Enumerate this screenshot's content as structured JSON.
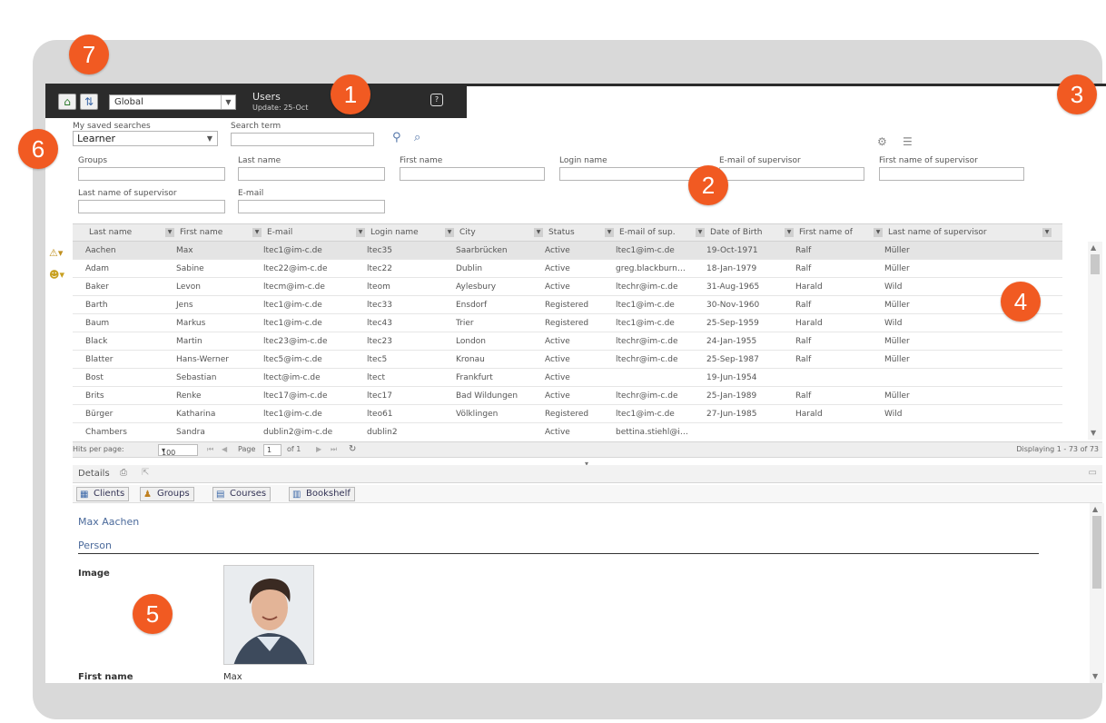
{
  "toolbar": {
    "context_select": "Global",
    "title": "Users",
    "subtitle": "Update: 25-Oct",
    "help_label": "?"
  },
  "search": {
    "saved_searches_label": "My saved searches",
    "saved_search_value": "Learner",
    "search_term_label": "Search term",
    "fields": [
      {
        "label": "Groups"
      },
      {
        "label": "Last name"
      },
      {
        "label": "First name"
      },
      {
        "label": "Login name"
      },
      {
        "label": "E-mail of supervisor"
      },
      {
        "label": "First name of supervisor"
      },
      {
        "label": "Last name of supervisor"
      },
      {
        "label": "E-mail"
      }
    ]
  },
  "grid": {
    "columns": [
      "Last name",
      "First name",
      "E-mail",
      "Login name",
      "City",
      "Status",
      "E-mail of sup.",
      "Date of Birth",
      "First name of",
      "Last name of supervisor"
    ],
    "rows": [
      [
        "Aachen",
        "Max",
        "ltec1@im-c.de",
        "ltec35",
        "Saarbrücken",
        "Active",
        "ltec1@im-c.de",
        "19-Oct-1971",
        "Ralf",
        "Müller"
      ],
      [
        "Adam",
        "Sabine",
        "ltec22@im-c.de",
        "ltec22",
        "Dublin",
        "Active",
        "greg.blackburn…",
        "18-Jan-1979",
        "Ralf",
        "Müller"
      ],
      [
        "Baker",
        "Levon",
        "ltecm@im-c.de",
        "lteom",
        "Aylesbury",
        "Active",
        "ltechr@im-c.de",
        "31-Aug-1965",
        "Harald",
        "Wild"
      ],
      [
        "Barth",
        "Jens",
        "ltec1@im-c.de",
        "ltec33",
        "Ensdorf",
        "Registered",
        "ltec1@im-c.de",
        "30-Nov-1960",
        "Ralf",
        "Müller"
      ],
      [
        "Baum",
        "Markus",
        "ltec1@im-c.de",
        "ltec43",
        "Trier",
        "Registered",
        "ltec1@im-c.de",
        "25-Sep-1959",
        "Harald",
        "Wild"
      ],
      [
        "Black",
        "Martin",
        "ltec23@im-c.de",
        "ltec23",
        "London",
        "Active",
        "ltechr@im-c.de",
        "24-Jan-1955",
        "Ralf",
        "Müller"
      ],
      [
        "Blatter",
        "Hans-Werner",
        "ltec5@im-c.de",
        "ltec5",
        "Kronau",
        "Active",
        "ltechr@im-c.de",
        "25-Sep-1987",
        "Ralf",
        "Müller"
      ],
      [
        "Bost",
        "Sebastian",
        "ltect@im-c.de",
        "ltect",
        "Frankfurt",
        "Active",
        "",
        "19-Jun-1954",
        "",
        ""
      ],
      [
        "Brits",
        "Renke",
        "ltec17@im-c.de",
        "ltec17",
        "Bad Wildungen",
        "Active",
        "ltechr@im-c.de",
        "25-Jan-1989",
        "Ralf",
        "Müller"
      ],
      [
        "Bürger",
        "Katharina",
        "ltec1@im-c.de",
        "lteo61",
        "Völklingen",
        "Registered",
        "ltec1@im-c.de",
        "27-Jun-1985",
        "Harald",
        "Wild"
      ],
      [
        "Chambers",
        "Sandra",
        "dublin2@im-c.de",
        "dublin2",
        "",
        "Active",
        "bettina.stiehl@i…",
        "",
        "",
        ""
      ]
    ]
  },
  "pager": {
    "hits_label": "Hits per page:",
    "hits_value": "100",
    "page_label": "Page",
    "page_value": "1",
    "of_label": "of 1",
    "displaying": "Displaying 1 - 73 of 73"
  },
  "details": {
    "title": "Details",
    "tabs": [
      "Clients",
      "Groups",
      "Courses",
      "Bookshelf"
    ],
    "person_name": "Max Aachen",
    "section": "Person",
    "image_label": "Image",
    "first_name_label": "First name",
    "first_name_value": "Max"
  },
  "badges": [
    "1",
    "2",
    "3",
    "4",
    "5",
    "6",
    "7"
  ],
  "colors": {
    "badge": "#f15a22",
    "topbar": "#2b2b2b",
    "link": "#4b6a9b"
  }
}
